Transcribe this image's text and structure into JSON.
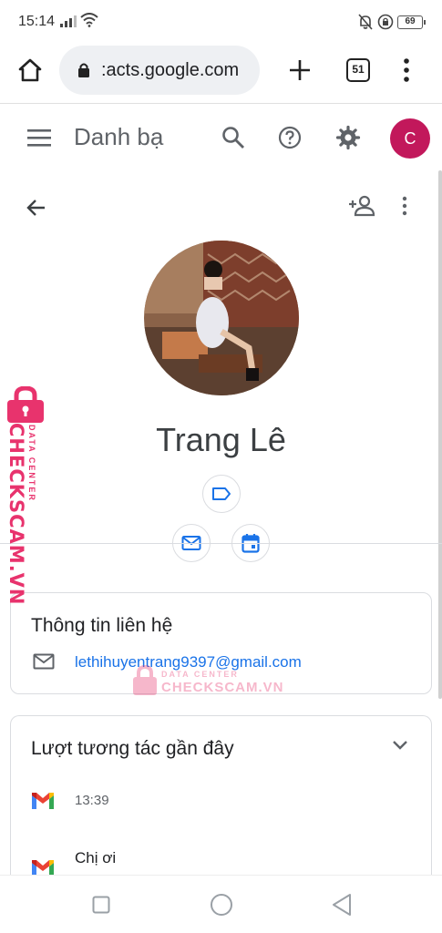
{
  "status_bar": {
    "time": "15:14",
    "battery": "69",
    "icons": [
      "signal-icon",
      "wifi-icon",
      "bell-off-icon",
      "lock-rotation-icon",
      "battery-icon"
    ]
  },
  "browser": {
    "url": ":acts.google.com",
    "tab_count": "51",
    "icons": [
      "home-icon",
      "lock-icon",
      "plus-icon",
      "tabs-icon",
      "more-vert-icon"
    ]
  },
  "app_header": {
    "title": "Danh bạ",
    "avatar_initial": "C",
    "icons": [
      "menu-icon",
      "search-icon",
      "help-icon",
      "settings-icon"
    ]
  },
  "contact": {
    "name": "Trang Lê",
    "icons": [
      "arrow-back-icon",
      "person-add-icon",
      "more-vert-icon",
      "label-icon",
      "mail-icon",
      "calendar-icon"
    ]
  },
  "contact_info": {
    "title": "Thông tin liên hệ",
    "email": "lethihuyentrang9397@gmail.com"
  },
  "interactions": {
    "title": "Lượt tương tác gần đây",
    "items": [
      {
        "time": "13:39"
      },
      {
        "text": "Chị ơi"
      }
    ]
  },
  "watermark": {
    "brand": "CHECKSCAM.VN",
    "sub": "DATA CENTER"
  },
  "colors": {
    "avatar": "#c2185b",
    "link": "#1a73e8",
    "watermark": "#e8336d"
  }
}
